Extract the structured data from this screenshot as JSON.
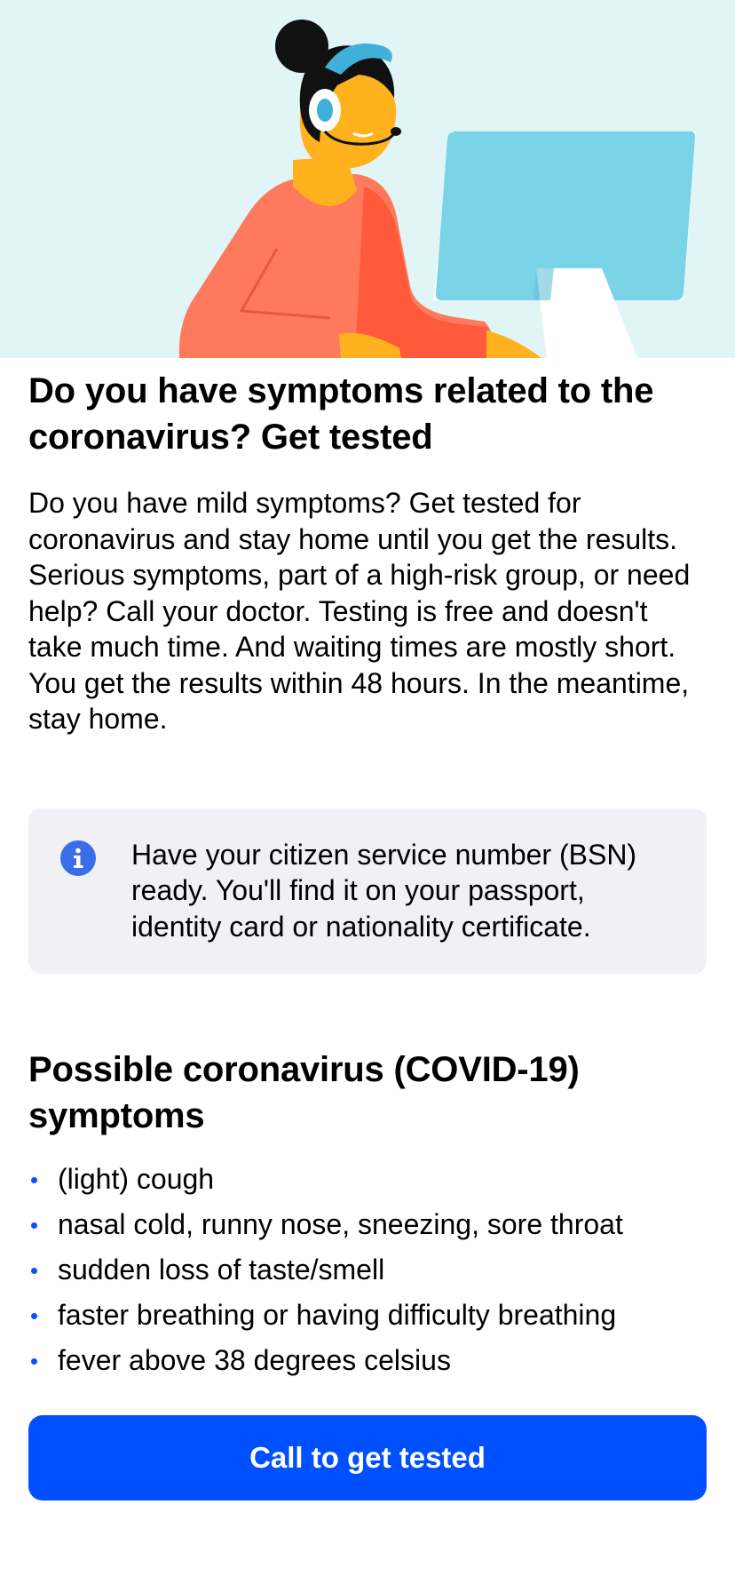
{
  "header": {
    "illustration_icon": "helpdesk-agent-at-computer-illustration"
  },
  "main": {
    "title": "Do you have symptoms related to the coronavirus? Get tested",
    "intro": "Do you have mild symptoms? Get tested for coronavirus and stay home until you get the results. Serious symptoms, part of a high-risk group, or need help? Call your doctor. Testing is free and doesn't take much time. And waiting times are mostly short. You get the results within 48 hours. In the meantime, stay home."
  },
  "info": {
    "icon": "info-icon",
    "text": "Have your citizen service number (BSN) ready. You'll find it on your passport, identity card or nationality certificate."
  },
  "symptoms": {
    "title": "Possible coronavirus (COVID-19) symptoms",
    "items": [
      {
        "label": "(light) cough"
      },
      {
        "label": "nasal cold, runny nose, sneezing, sore throat"
      },
      {
        "label": "sudden loss of taste/smell"
      },
      {
        "label": "faster breathing or having difficulty breathing"
      },
      {
        "label": "fever above 38 degrees celsius"
      }
    ]
  },
  "cta": {
    "label": "Call to get tested"
  },
  "colors": {
    "accent": "#0050ff",
    "hero_background": "#e1f5f7",
    "info_background": "#f0f0f5",
    "info_icon": "#3a6ee8"
  }
}
